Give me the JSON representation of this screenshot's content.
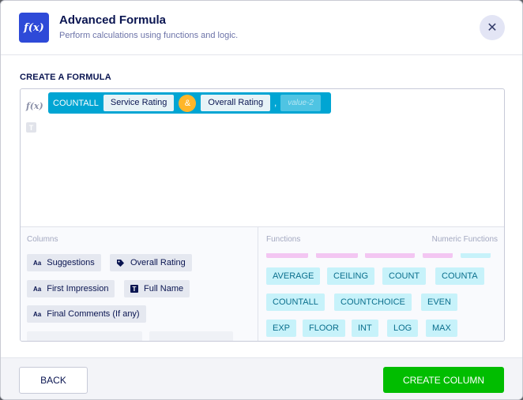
{
  "header": {
    "icon_text": "f(x)",
    "title": "Advanced Formula",
    "subtitle": "Perform calculations using functions and logic.",
    "close_glyph": "✕"
  },
  "section_label": "CREATE A FORMULA",
  "editor": {
    "fx_label": "f(x)",
    "t_label": "T",
    "formula": {
      "function": "COUNTALL",
      "args": [
        "Service Rating",
        "Overall Rating"
      ],
      "operator": "&",
      "separator": ",",
      "placeholder": "value-2"
    }
  },
  "columns_pane": {
    "label": "Columns",
    "items": [
      {
        "label": "Suggestions",
        "icon": "Aa"
      },
      {
        "label": "Overall Rating",
        "icon": "tag-icon"
      },
      {
        "label": "First Impression",
        "icon": "Aa"
      },
      {
        "label": "Full Name",
        "icon": "T"
      },
      {
        "label": "Final Comments (If any)",
        "icon": "Aa"
      }
    ]
  },
  "functions_pane": {
    "label": "Functions",
    "category": "Numeric Functions",
    "items": [
      "AVERAGE",
      "CEILING",
      "COUNT",
      "COUNTA",
      "COUNTALL",
      "COUNTCHOICE",
      "EVEN",
      "EXP",
      "FLOOR",
      "INT",
      "LOG",
      "MAX"
    ]
  },
  "footer": {
    "back_label": "BACK",
    "create_label": "CREATE COLUMN"
  },
  "colors": {
    "brand_blue": "#2e4ad8",
    "formula_teal": "#00a5d3",
    "operator_orange": "#ffb629",
    "create_green": "#01bd00",
    "function_chip": "#c7f2fa"
  }
}
